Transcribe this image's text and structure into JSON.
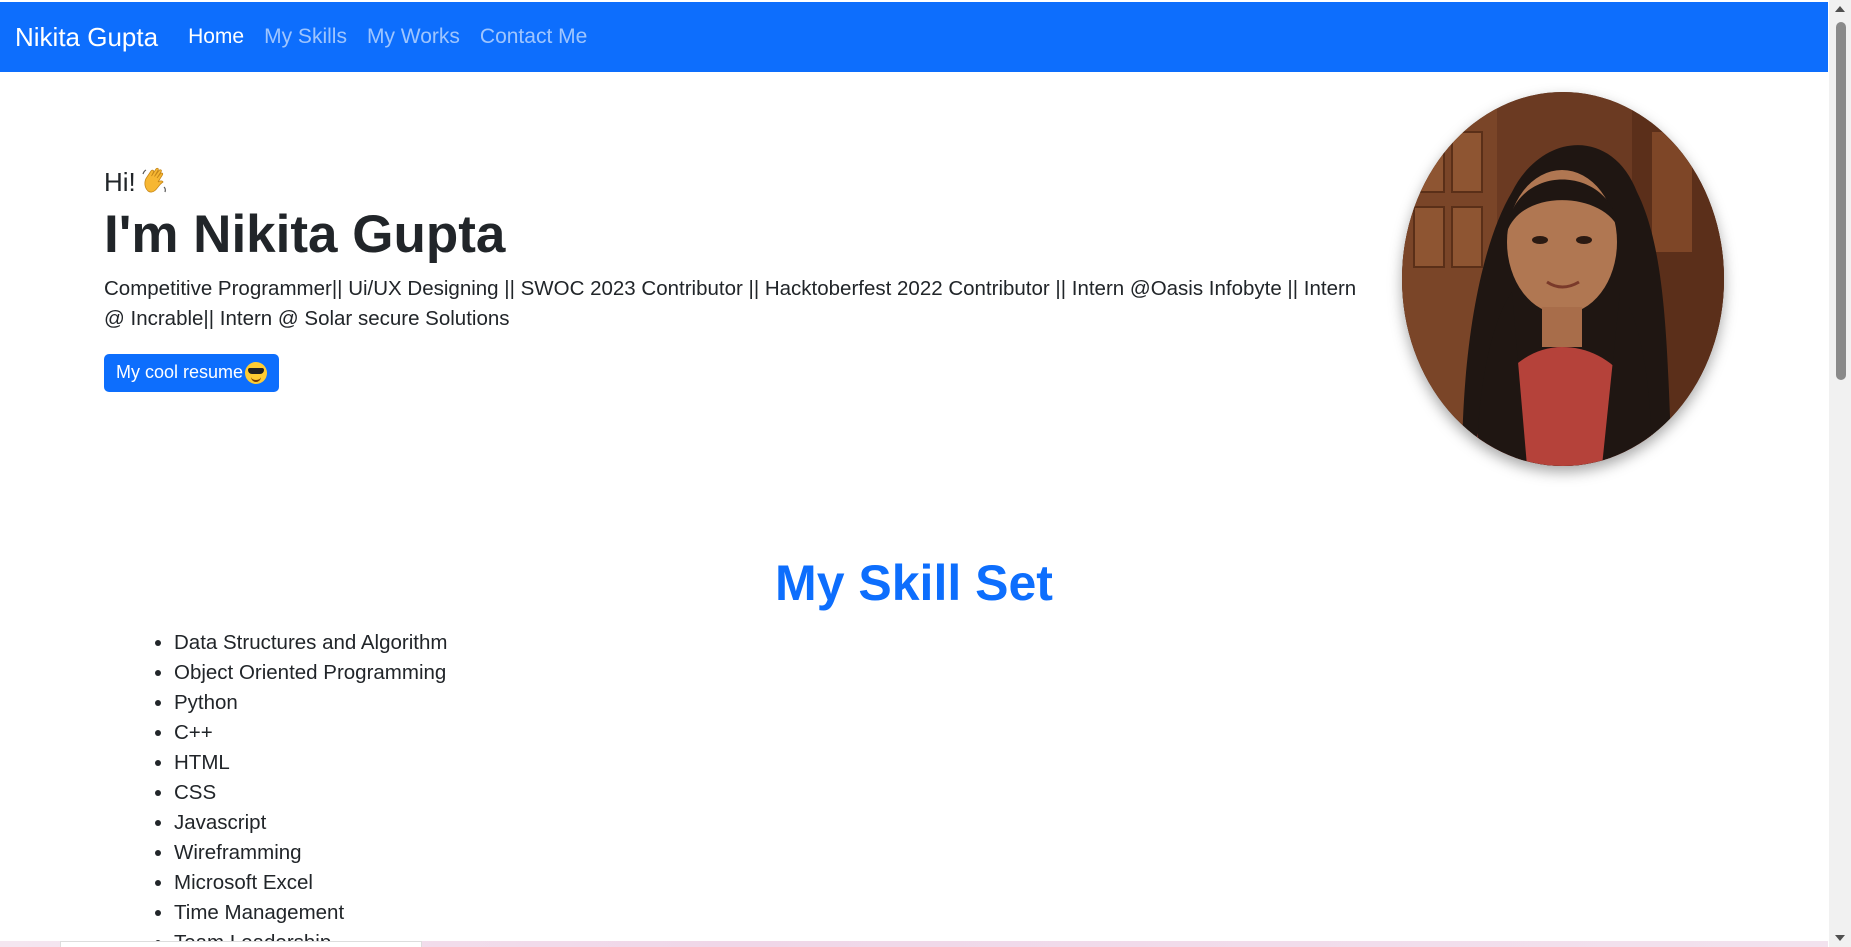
{
  "navbar": {
    "brand": "Nikita Gupta",
    "links": [
      {
        "label": "Home",
        "active": true
      },
      {
        "label": "My Skills",
        "active": false
      },
      {
        "label": "My Works",
        "active": false
      },
      {
        "label": "Contact Me",
        "active": false
      }
    ],
    "color": "#0d6efd"
  },
  "hero": {
    "greeting": "Hi!",
    "greeting_icon": "waving-hand-icon",
    "name": "I'm Nikita Gupta",
    "tagline": "Competitive Programmer|| Ui/UX Designing || SWOC 2023 Contributor || Hacktoberfest 2022 Contributor || Intern @Oasis Infobyte || Intern @ Incrable|| Intern @ Solar secure Solutions",
    "resume_button": "My cool resume",
    "resume_icon": "sunglasses-face-icon"
  },
  "skills": {
    "title": "My Skill Set",
    "items": [
      "Data Structures and Algorithm",
      "Object Oriented Programming",
      "Python",
      "C++",
      "HTML",
      "CSS",
      "Javascript",
      "Wireframming",
      "Microsoft Excel",
      "Time Management",
      "Team Leadership"
    ]
  },
  "colors": {
    "accent": "#0d6efd",
    "text": "#212529"
  }
}
